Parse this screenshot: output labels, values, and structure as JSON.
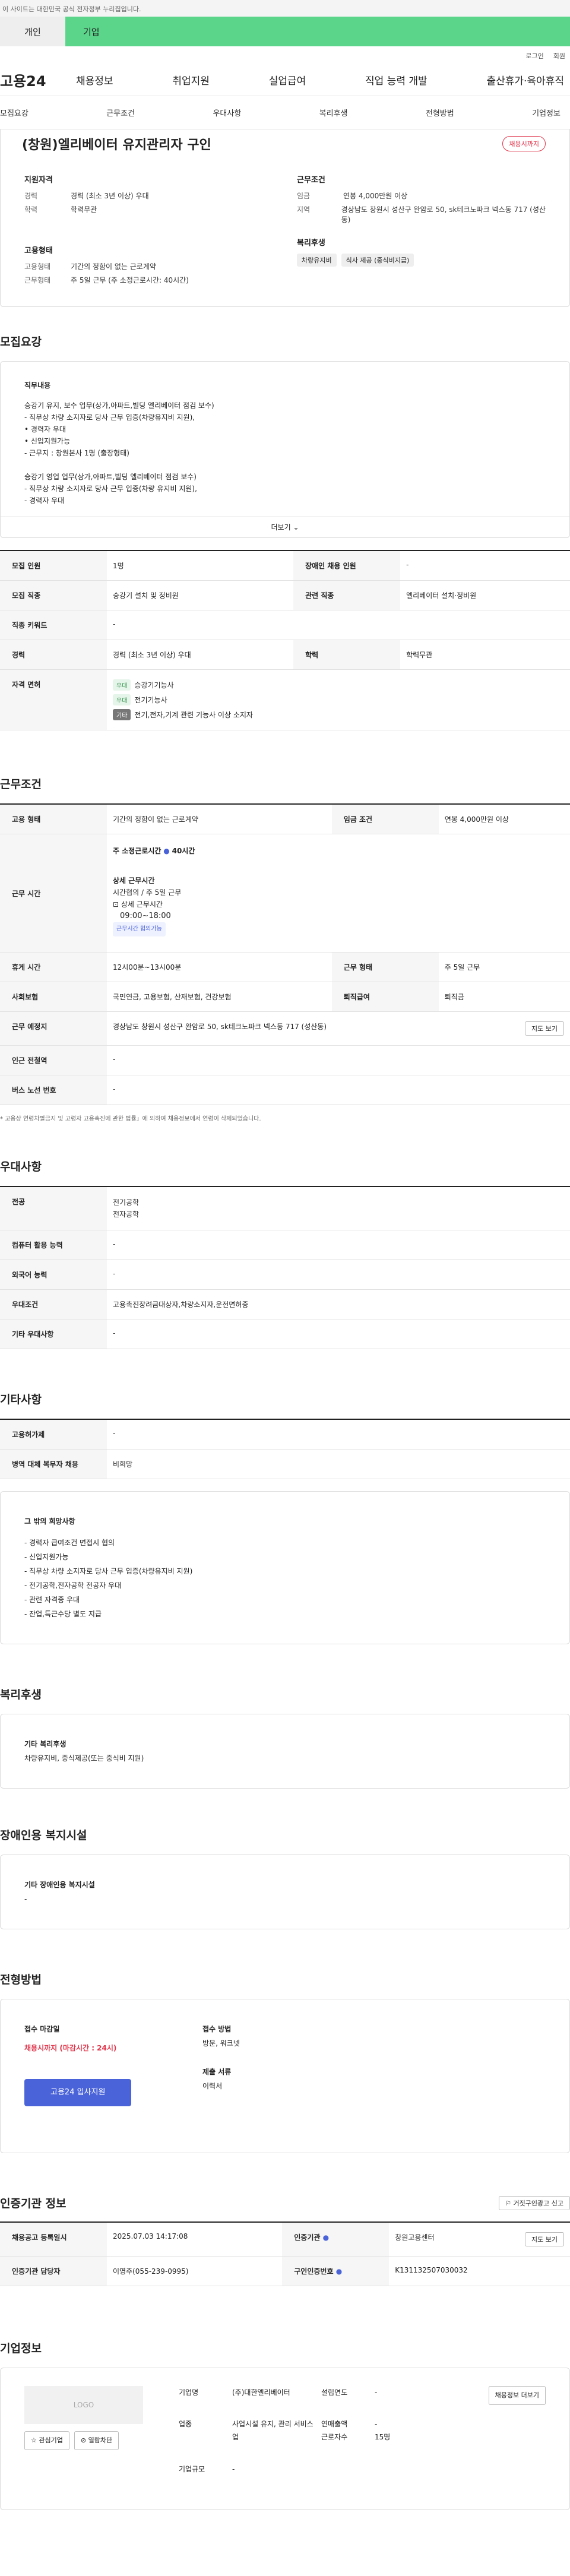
{
  "top_notice": "이 사이트는 대한민국 공식 전자정부 누리집입니다.",
  "service_tabs": [
    "개인",
    "기업"
  ],
  "util": [
    "로그인",
    "회원"
  ],
  "logo": "고용24",
  "gnb": [
    "채용정보",
    "취업지원",
    "실업급여",
    "직업 능력 개발",
    "출산휴가·육아휴직"
  ],
  "tabs": [
    "모집요강",
    "근무조건",
    "우대사항",
    "복리후생",
    "전형방법",
    "기업정보"
  ],
  "job": {
    "title": "(창원)엘리베이터 유지관리자 구인",
    "status": "채용시까지",
    "q_head": "지원자격",
    "cond_head": "근무조건",
    "exp_k": "경력",
    "exp_v": "경력 (최소 3년 이상) 우대",
    "edu_k": "학력",
    "edu_v": "학력무관",
    "wage_k": "임금",
    "wage_v": "연봉 4,000만원 이상",
    "area_k": "지역",
    "area_v": "경상남도 창원시 성산구 완암로 50, sk테크노파크 넥스동 717 (성산동)",
    "emp_head": "고용형태",
    "emptype_k": "고용형태",
    "emptype_v": "기간의 정함이 없는 근로계약",
    "work_k": "근무형태",
    "work_v": "주 5일 근무 (주 소정근로시간: 40시간)",
    "welfare_head": "복리후생",
    "chips": [
      "차량유지비",
      "식사 제공 (중식비지급)"
    ]
  },
  "recruit": {
    "title": "모집요강",
    "desc_head": "직무내용",
    "desc": [
      "승강기 유지, 보수 업무(상가,아파트,빌딩 엘리베이터 점검 보수)",
      "- 직무상 차량 소지자로 당사 근무 입증(차량유지비 지원),",
      "• 경력자 우대",
      "• 신입지원가능",
      "- 근무지 : 창원본사 1명 (출장형태)",
      "",
      "승강기 영업 업무(상가,아파트,빌딩 엘리베이터 점검 보수)",
      "- 직무상 차량 소지자로 당사 근무 입증(차량 유지비 지원),",
      "- 경력자 우대"
    ],
    "more": "더보기",
    "rows": [
      [
        "모집 인원",
        "1명",
        "장애인 채용 인원",
        "-"
      ],
      [
        "모집 직종",
        "승강기 설치 및 정비원",
        "관련 직종",
        "엘리베이터 설치·정비원"
      ],
      [
        "직종 키워드",
        "-"
      ],
      [
        "경력",
        "경력 (최소 3년 이상) 우대",
        "학력",
        "학력무관"
      ]
    ],
    "license_k": "자격 면허",
    "licenses": [
      [
        "우대",
        "승강기기능사"
      ],
      [
        "우대",
        "전기기능사"
      ],
      [
        "기타",
        "전기,전자,기계 관련 기능사 이상 소지자"
      ]
    ]
  },
  "conditions": {
    "title": "근무조건",
    "r1": [
      "고용 형태",
      "기간의 정함이 없는 근로계약",
      "임금 조건",
      "연봉 4,000만원 이상"
    ],
    "time_k": "근무 시간",
    "time_head": "주 소정근로시간",
    "time_hours": "40시간",
    "detail_head": "상세 근무시간",
    "detail_lines": [
      "시간협의 / 주 5일 근무",
      "상세 근무시간",
      "09:00~18:00"
    ],
    "flex": "근무시간 협의가능",
    "r3": [
      "휴게 시간",
      "12시00분~13시00분",
      "근무 형태",
      "주 5일 근무"
    ],
    "r4": [
      "사회보험",
      "국민연금, 고용보험, 산재보험, 건강보험",
      "퇴직급여",
      "퇴직금"
    ],
    "place": [
      "근무 예정지",
      "경상남도 창원시 성산구 완암로 50, sk테크노파크 넥스동 717 (성산동)",
      "지도 보기"
    ],
    "r6": [
      "인근 전철역",
      "-"
    ],
    "r7": [
      "버스 노선 번호",
      "-"
    ],
    "note": "* 고용상 연령차별금지 및 고령자 고용촉진에 관한 법률」에 의하여 채용정보에서 연령이 삭제되었습니다."
  },
  "pref": {
    "title": "우대사항",
    "major_k": "전공",
    "majors": [
      "전기공학",
      "전자공학"
    ],
    "rows": [
      [
        "컴퓨터 활용 능력",
        "-"
      ],
      [
        "외국어 능력",
        "-"
      ],
      [
        "우대조건",
        "고용촉진장려금대상자,차량소지자,운전면허증"
      ],
      [
        "기타 우대사항",
        "-"
      ]
    ]
  },
  "etc": {
    "title": "기타사항",
    "rows": [
      [
        "고용허가제",
        "-"
      ],
      [
        "병역 대체 복무자 채용",
        "비희망"
      ]
    ],
    "box_head": "그 밖의 희망사항",
    "box": [
      "- 경력자 급여조건 면접시 협의",
      "- 신입지원가능",
      "- 직무상 차량 소지자로 당사 근무 입증(차량유지비 지원)",
      "- 전기공학,전자공학 전공자 우대",
      "- 관련 자격증 우대",
      "- 잔업,특근수당 별도 지급"
    ]
  },
  "welfare": {
    "title": "복리후생",
    "head": "기타 복리후생",
    "text": "차량유지비, 중식제공(또는 중식비 지원)"
  },
  "disabled": {
    "title": "장애인용 복지시설",
    "head": "기타 장애인용 복지시설",
    "text": "-"
  },
  "apply": {
    "title": "전형방법",
    "deadline_head": "접수 마감일",
    "deadline": "채용시까지 (마감시간 : 24시)",
    "btn": "고용24 입사지원",
    "method_head": "접수 방법",
    "method": "방문, 워크넷",
    "docs_head": "제출 서류",
    "docs": "이력서"
  },
  "cert": {
    "title": "인증기관 정보",
    "report": "거짓구인광고 신고",
    "r1": [
      "채용공고 등록일시",
      "2025.07.03 14:17:08",
      "인증기관",
      "창원고용센터",
      "지도 보기"
    ],
    "r2": [
      "인증기관 담당자",
      "이영주(055-239-0995)",
      "구인인증번호",
      "K131132507030032"
    ]
  },
  "company": {
    "title": "기업정보",
    "logo": "LOGO",
    "fav": "관심기업",
    "block": "열람차단",
    "name_k": "기업명",
    "name_v": "(주)대한엘리베이터",
    "year_k": "설립연도",
    "year_v": "-",
    "btn": "채용정보 더보기",
    "ind_k": "업종",
    "ind_v": "사업시설 유지, 관리 서비스업",
    "sales_k": "연매출액",
    "sales_v": "-",
    "emp_k": "근로자수",
    "emp_v": "15명",
    "size_k": "기업규모",
    "size_v": "-"
  }
}
